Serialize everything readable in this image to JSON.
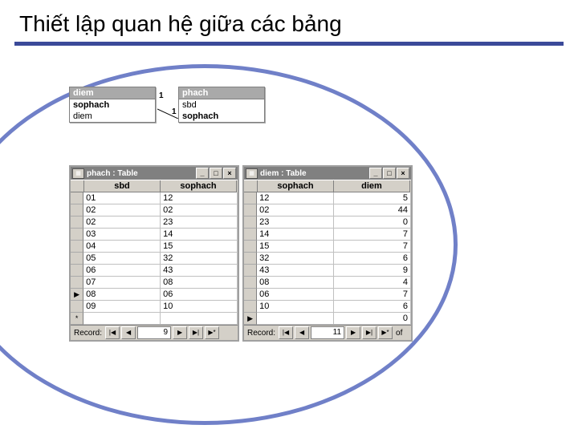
{
  "title": "Thiết lập quan hệ giữa các bảng",
  "relations": {
    "box1": {
      "title": "diem",
      "fields": [
        "sophach",
        "diem"
      ]
    },
    "box2": {
      "title": "phach",
      "fields": [
        "sbd",
        "sophach"
      ]
    },
    "link": {
      "left_card": "1",
      "right_card": "1"
    }
  },
  "phach_table": {
    "title": "phach : Table",
    "columns": [
      "sbd",
      "sophach"
    ],
    "rows": [
      [
        "01",
        "12"
      ],
      [
        "02",
        "02"
      ],
      [
        "02",
        "23"
      ],
      [
        "03",
        "14"
      ],
      [
        "04",
        "15"
      ],
      [
        "05",
        "32"
      ],
      [
        "06",
        "43"
      ],
      [
        "07",
        "08"
      ],
      [
        "08",
        "06"
      ],
      [
        "09",
        "10"
      ]
    ],
    "current_row_index": 8,
    "record_label": "Record:",
    "record_current": "9"
  },
  "diem_table": {
    "title": "diem : Table",
    "columns": [
      "sophach",
      "diem"
    ],
    "rows": [
      [
        "12",
        "5"
      ],
      [
        "02",
        "44"
      ],
      [
        "23",
        "0"
      ],
      [
        "14",
        "7"
      ],
      [
        "15",
        "7"
      ],
      [
        "32",
        "6"
      ],
      [
        "43",
        "9"
      ],
      [
        "08",
        "4"
      ],
      [
        "06",
        "7"
      ],
      [
        "10",
        "6"
      ],
      [
        "",
        "0"
      ]
    ],
    "current_row_index": 10,
    "record_label": "Record:",
    "record_current": "11",
    "of_label": "of"
  },
  "glyphs": {
    "minimize": "_",
    "maximize": "□",
    "close": "×",
    "first": "|◀",
    "prev": "◀",
    "next": "▶",
    "last": "▶|",
    "new": "▶*",
    "pointer": "▶",
    "newrow": "*",
    "grid_icon": "▦"
  }
}
